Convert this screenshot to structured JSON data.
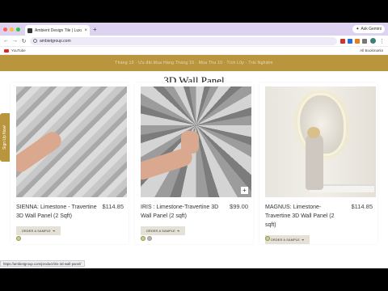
{
  "browser": {
    "tab_title": "Ambient Design Tile | Luxury ...",
    "tab_close": "×",
    "new_tab": "+",
    "address": "ambietgroup.com",
    "gemini_label": "Ask Gemini",
    "bookmark_youtube": "YouTube",
    "all_bookmarks": "All Bookmarks",
    "status_url": "https://ambietgroup.com/product/iris-3d-wall-panel/"
  },
  "promo": {
    "text": "Tháng 10 · Ưu đãi Mua Hàng Tháng 10 · Mùa Thu 10 · Tích Lũy · Trải Nghiệm"
  },
  "page": {
    "heading": "3D Wall Panel",
    "sidetab": "Sign Up Now!"
  },
  "products": [
    {
      "name": "SIENNA: Limestone - Travertine 3D Wall Panel (2 Sqft)",
      "price": "$114.85",
      "button": "ORDER A SAMPLE"
    },
    {
      "name": "IRIS : Limestone-Travertine 3D Wall Panel (2 sqft)",
      "price": "$99.00",
      "button": "ORDER A SAMPLE"
    },
    {
      "name": "MAGNUS: Limestone- Travertine 3D Wall Panel (2 sqft)",
      "price": "$114.85",
      "button": "ORDER A SAMPLE"
    }
  ],
  "colors": {
    "gold": "#b9953d",
    "button_bg": "#e6e1d6",
    "tab_bar": "#ddd3f0"
  }
}
